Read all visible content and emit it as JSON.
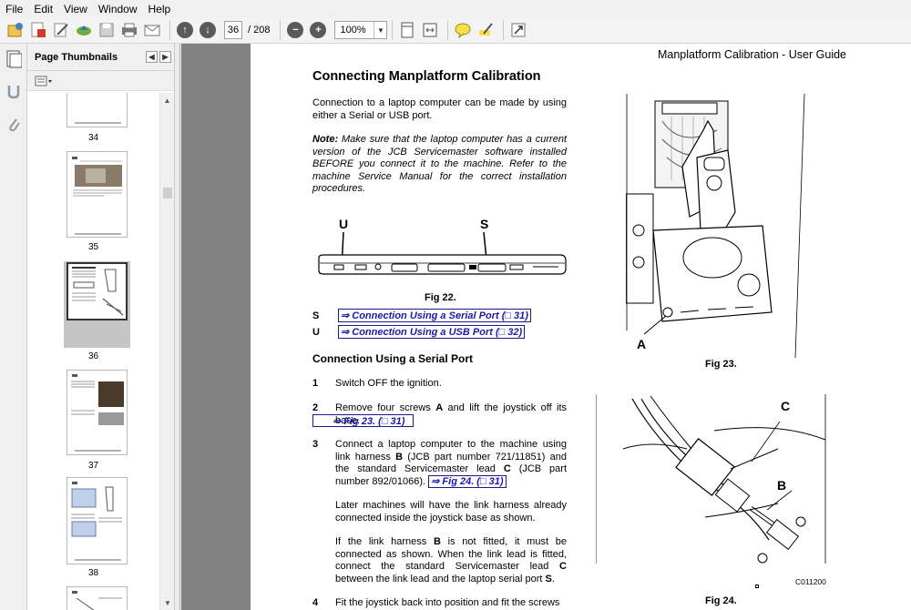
{
  "menu": [
    "File",
    "Edit",
    "View",
    "Window",
    "Help"
  ],
  "toolbar": {
    "current_page": "36",
    "page_total": "/ 208",
    "zoom": "100%"
  },
  "thumbnails": {
    "title": "Page Thumbnails",
    "pages": [
      {
        "num": "34"
      },
      {
        "num": "35"
      },
      {
        "num": "36"
      },
      {
        "num": "37"
      },
      {
        "num": "38"
      }
    ]
  },
  "document": {
    "running_header": "Manplatform Calibration - User Guide",
    "title": "Connecting Manplatform Calibration",
    "intro": "Connection to a laptop computer can be made by using either a Serial or USB port.",
    "note_label": "Note:",
    "note_text": " Make sure that the laptop computer has a current version of the JCB Servicemaster software installed BEFORE you connect it to the machine. Refer to the machine Service Manual for the correct installation procedures.",
    "fig22": {
      "caption": "Fig 22.",
      "label_u": "U",
      "label_s": "S"
    },
    "refs": [
      {
        "letter": "S",
        "link": "⇒ Connection Using a Serial Port (□ 31)"
      },
      {
        "letter": "U",
        "link": "⇒ Connection Using a USB Port (□ 32)"
      }
    ],
    "section_heading": "Connection Using a Serial Port",
    "steps": {
      "s1_num": "1",
      "s1_text": "Switch OFF the ignition.",
      "s2_num": "2",
      "s2_pre": "Remove four screws ",
      "s2_bold": "A",
      "s2_post": " and lift the joystick off its base.",
      "s2_link": "⇒ Fig 23. (□ 31)",
      "s3_num": "3",
      "s3_a": "Connect a laptop computer to the machine using link harness ",
      "s3_b": "B",
      "s3_c": " (JCB part number 721/11851) and the standard Servicemaster lead ",
      "s3_d": "C",
      "s3_e": " (JCB part number 892/01066). ",
      "s3_link": "⇒ Fig 24. (□ 31)",
      "s3_p2": "Later machines will have the link harness already connected inside the joystick base as shown.",
      "s3_p3a": "If the link harness ",
      "s3_p3b": "B",
      "s3_p3c": " is not fitted, it must be connected as shown. When the link lead is fitted, connect the standard Servicemaster lead ",
      "s3_p3d": "C",
      "s3_p3e": " between the link lead and the laptop serial port ",
      "s3_p3f": "S",
      "s3_p3g": ".",
      "s4_num": "4",
      "s4_text": "Fit the joystick back into position and fit the screws"
    },
    "fig23": {
      "caption": "Fig 23.",
      "label_a": "A"
    },
    "fig24": {
      "caption": "Fig 24.",
      "label_b": "B",
      "label_c": "C",
      "code": "C011200"
    }
  }
}
